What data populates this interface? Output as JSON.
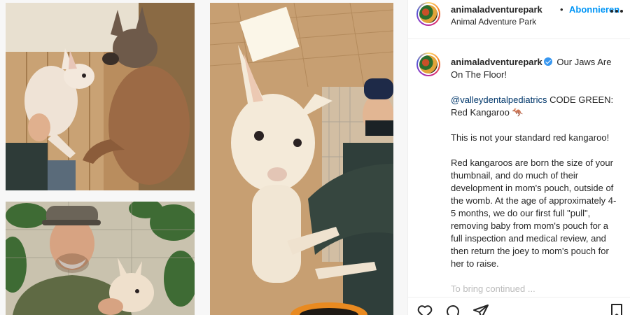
{
  "post": {
    "username_header": "animaladventurepark",
    "separator": "•",
    "follow_label": "Abonnieren",
    "location": "Animal Adventure Park"
  },
  "caption": {
    "username": "animaladventurepark",
    "title": "Our Jaws Are On The Floor!",
    "mention": "@valleydentalpediatrics",
    "code_line": "CODE GREEN: Red Kangaroo 🦘",
    "para1": "This is not your standard red kangaroo!",
    "para2": "Red kangaroos are born the size of your thumbnail, and do much of their development in mom's pouch, outside of the womb. At the age of approximately 4-5 months, we do our first full \"pull\", removing baby from mom's pouch for a full inspection and medical review, and then return the joey to mom's pouch for her to raise.",
    "para3_partial": "To bring continued ..."
  },
  "icons": {
    "more": "more-options-icon",
    "like": "heart-icon",
    "comment": "comment-icon",
    "share": "share-icon",
    "save": "bookmark-icon",
    "verified": "verified-badge-icon"
  },
  "colors": {
    "link": "#0095f6",
    "mention": "#00376b",
    "verified": "#3897f0"
  }
}
